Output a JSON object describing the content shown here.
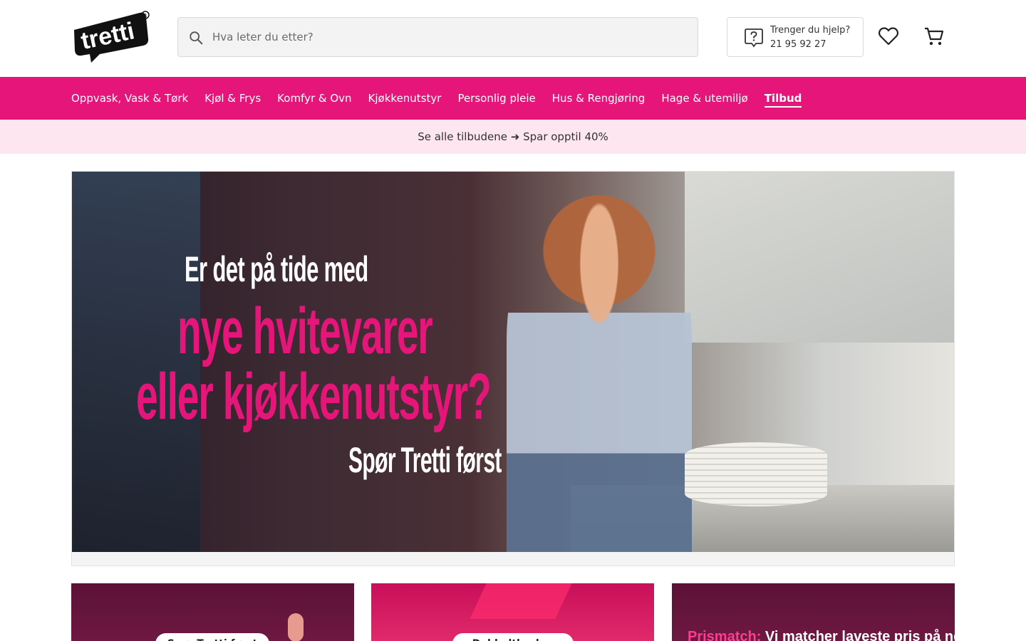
{
  "header": {
    "logo_text": "tretti",
    "search_placeholder": "Hva leter du etter?",
    "help_title": "Trenger du hjelp?",
    "help_phone": "21 95 92 27"
  },
  "nav": {
    "items": [
      {
        "label": "Oppvask, Vask & Tørk"
      },
      {
        "label": "Kjøl & Frys"
      },
      {
        "label": "Komfyr & Ovn"
      },
      {
        "label": "Kjøkkenutstyr"
      },
      {
        "label": "Personlig pleie"
      },
      {
        "label": "Hus & Rengjøring"
      },
      {
        "label": "Hage & utemiljø"
      },
      {
        "label": "Tilbud"
      }
    ],
    "active_index": 7
  },
  "promo": {
    "text": "Se alle tilbudene ➜ Spar opptil 40%"
  },
  "hero": {
    "line1": "Er det på tide med",
    "line2": "nye hvitevarer",
    "line3": "eller kjøkkenutstyr?",
    "line4": "Spør Tretti først"
  },
  "cards": [
    {
      "pill": "Spør Tretti først"
    },
    {
      "pill": "Dobbeltbruker"
    },
    {
      "highlight": "Prismatch:",
      "text": " Vi matcher laveste pris på nett"
    }
  ],
  "colors": {
    "brand_pink": "#e5157a",
    "promo_bg": "#fde6ef"
  }
}
